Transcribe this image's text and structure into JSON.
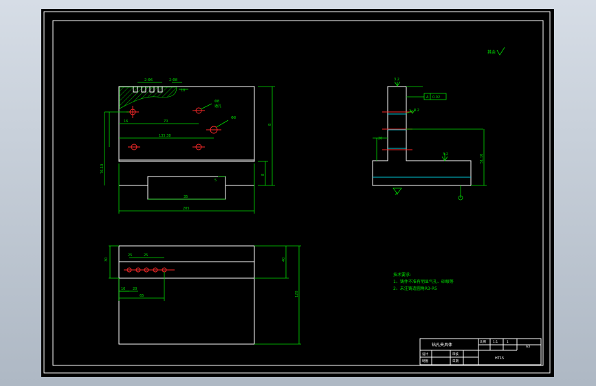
{
  "colors": {
    "background": "#000000",
    "geometry": "#ffffff",
    "dimension": "#00e000",
    "centerline": "#ff2a2a",
    "hidden_line": "#00c8d8"
  },
  "roughness_note": {
    "text": "其余"
  },
  "front_view": {
    "dims": {
      "pitch_a": "2-Φ6",
      "pitch_b": "2-Φ8",
      "tap_depth": "10",
      "hole_upper": "Φ8",
      "hole_upper_sub": "通孔",
      "hole_mid": "Φ8",
      "left_16": "16",
      "x_70": "70",
      "x_135": "135.38",
      "overall_height": "76.10",
      "slot_35": "35",
      "slot_5": "5",
      "width_205": "205",
      "height_right": "8",
      "height_r2": "8"
    }
  },
  "side_view": {
    "dims": {
      "top_rough": "3.2",
      "flatness": "0.02",
      "datum": "A",
      "angle": "3.2",
      "step_20": "20",
      "right_height": "51.10",
      "bottom_rough": "3.2",
      "datum_bottom": "A"
    }
  },
  "top_view": {
    "dims": {
      "d_25a": "25",
      "d_25b": "25",
      "left_30": "30",
      "d_10": "10",
      "d_20": "20",
      "d_65": "65",
      "right_40": "40",
      "right_120": "120"
    }
  },
  "notes": {
    "title": "技术要求:",
    "line1": "1、铸件不准有明显气孔、砂眼等",
    "line2": "2、未注铸造圆角R3-R5"
  },
  "title_block": {
    "part_name": "钻孔夹具体",
    "scale_label": "比例",
    "scale_value": "1:1",
    "qty": "1",
    "sheet": "A3",
    "designer_label": "设计",
    "drafter_label": "制图",
    "check_label": "审核",
    "date_label": "日期",
    "material": "HT15"
  }
}
